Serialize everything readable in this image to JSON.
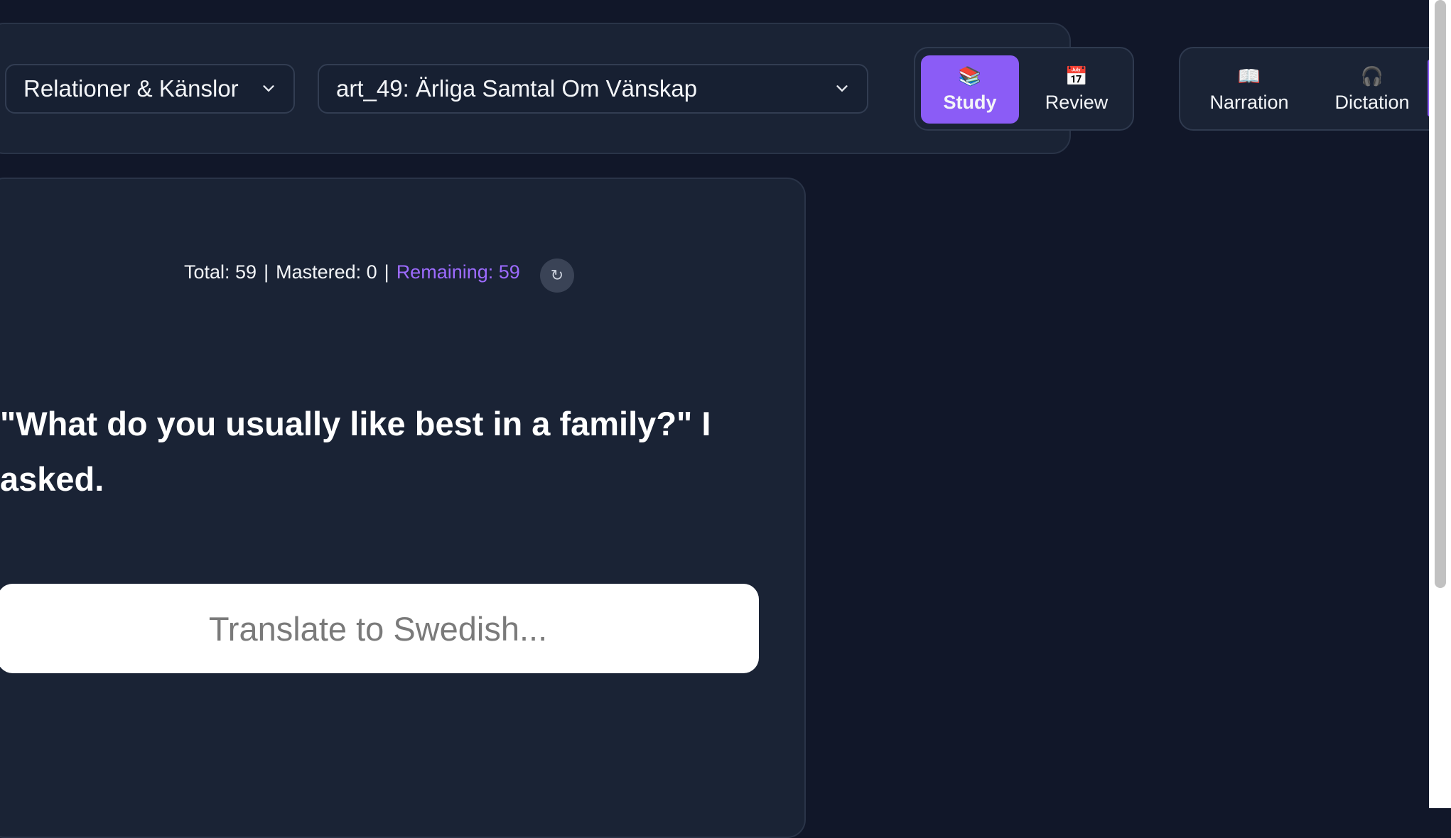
{
  "selectors": {
    "category": "Relationer & Känslor",
    "article": "art_49: Ärliga Samtal Om Vänskap"
  },
  "modes": {
    "study": {
      "label": "Study",
      "icon": "📚"
    },
    "review": {
      "label": "Review",
      "icon": "📅"
    },
    "narration": {
      "label": "Narration",
      "icon": "📖"
    },
    "dictation": {
      "label": "Dictation",
      "icon": "🎧"
    }
  },
  "stats": {
    "total": "Total: 59",
    "mastered": "Mastered: 0",
    "remaining": "Remaining: 59",
    "separator": "|",
    "refresh_icon": "↻"
  },
  "card": {
    "prompt": "\"What do you usually like best in a family?\" I asked.",
    "answer_placeholder": "Translate to Swedish...",
    "answer_value": ""
  },
  "colors": {
    "accent": "#8b5cf6",
    "remaining_text": "#9d6bff",
    "background": "#111729",
    "panel": "#1a2335"
  }
}
